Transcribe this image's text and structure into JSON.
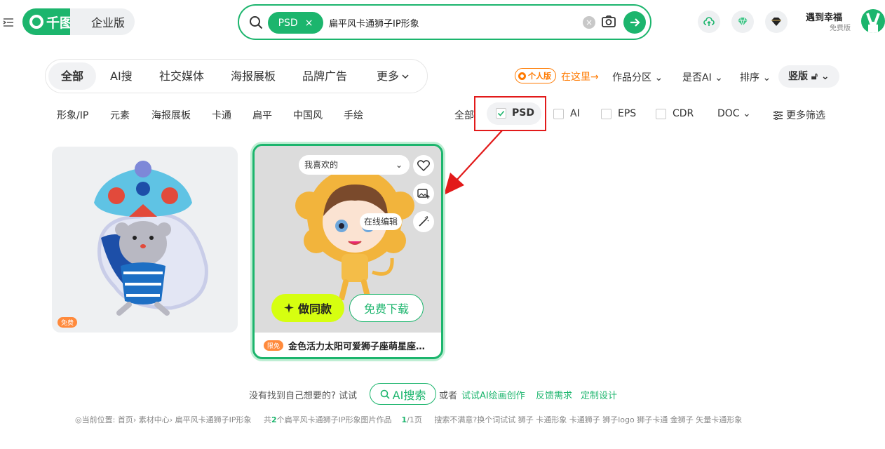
{
  "header": {
    "brand": "千图",
    "enterprise_label": "企业版",
    "search_tag": "PSD",
    "search_tag_close": "×",
    "search_query": "扁平风卡通狮子IP形象",
    "user_name": "遇到幸福",
    "user_level": "免费版",
    "brand_color": "#1cb56d"
  },
  "categories": [
    "全部",
    "AI搜",
    "社交媒体",
    "海报展板",
    "品牌广告",
    "更多"
  ],
  "filters": {
    "personal_badge": "个人版",
    "here_link": "在这里→",
    "zone": "作品分区",
    "is_ai": "是否AI",
    "sort": "排序",
    "orientation": "竖版"
  },
  "tags": [
    "形象/IP",
    "元素",
    "海报展板",
    "卡通",
    "扁平",
    "中国风",
    "手绘"
  ],
  "formats": {
    "all": "全部",
    "psd": "PSD",
    "ai": "AI",
    "eps": "EPS",
    "cdr": "CDR",
    "doc": "DOC",
    "more": "更多筛选"
  },
  "cards": [
    {
      "badge": "免费"
    },
    {
      "badge": "限免",
      "fav_select": "我喜欢的",
      "edit_tip": "在线编辑",
      "same_label": "做同款",
      "download_label": "免费下载",
      "title": "金色活力太阳可爱狮子座萌星座插画"
    }
  ],
  "footer": {
    "not_found": "没有找到自己想要的? 试试",
    "ai_search": "AI搜索",
    "or": "或者",
    "links": [
      "试试AI绘画创作",
      "反馈需求",
      "定制设计"
    ],
    "breadcrumb_prefix": "◎当前位置:",
    "crumbs": [
      "首页",
      "素材中心",
      "扁平风卡通狮子IP形象"
    ],
    "total_pre": "共",
    "total_count": "2",
    "total_post": "个扁平风卡通狮子IP形象图片作品",
    "page": "1",
    "page_total": "/1页",
    "suggest_label": "搜索不满意?换个词试试",
    "suggestions": [
      "狮子",
      "卡通形象",
      "卡通狮子",
      "狮子logo",
      "狮子卡通",
      "金狮子",
      "矢量卡通形象"
    ]
  }
}
